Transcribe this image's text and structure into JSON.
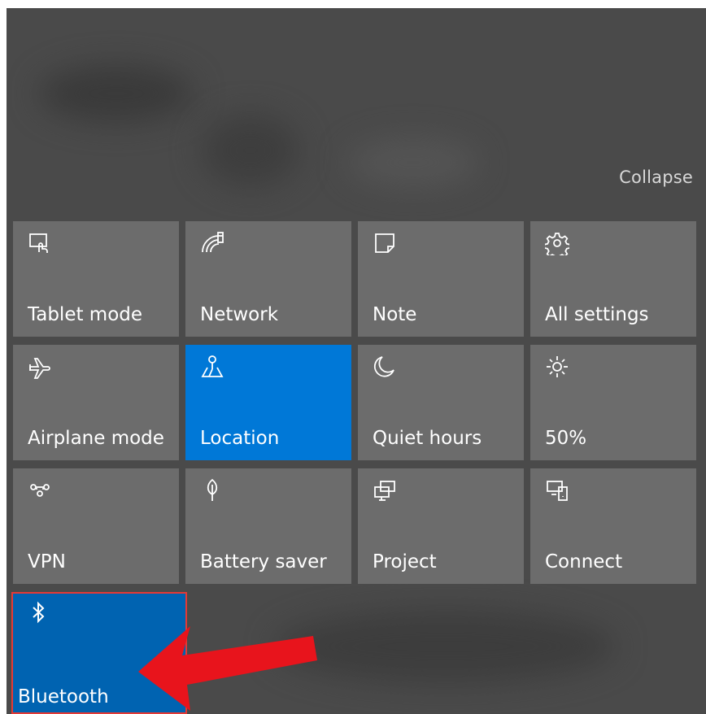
{
  "header": {
    "collapse_label": "Collapse"
  },
  "tiles": [
    {
      "label": "Tablet mode",
      "icon": "tablet-mode-icon",
      "active": false
    },
    {
      "label": "Network",
      "icon": "network-icon",
      "active": false
    },
    {
      "label": "Note",
      "icon": "note-icon",
      "active": false
    },
    {
      "label": "All settings",
      "icon": "gear-icon",
      "active": false
    },
    {
      "label": "Airplane mode",
      "icon": "airplane-icon",
      "active": false
    },
    {
      "label": "Location",
      "icon": "location-icon",
      "active": true
    },
    {
      "label": "Quiet hours",
      "icon": "moon-icon",
      "active": false
    },
    {
      "label": "50%",
      "icon": "brightness-icon",
      "active": false
    },
    {
      "label": "VPN",
      "icon": "vpn-icon",
      "active": false
    },
    {
      "label": "Battery saver",
      "icon": "battery-saver-icon",
      "active": false
    },
    {
      "label": "Project",
      "icon": "project-icon",
      "active": false
    },
    {
      "label": "Connect",
      "icon": "connect-icon",
      "active": false
    },
    {
      "label": "Bluetooth",
      "icon": "bluetooth-icon",
      "active": true
    }
  ],
  "colors": {
    "tile": "#6c6c6c",
    "tile_active": "#0078d7",
    "highlight": "#e53935",
    "background": "#4a4a4a"
  }
}
